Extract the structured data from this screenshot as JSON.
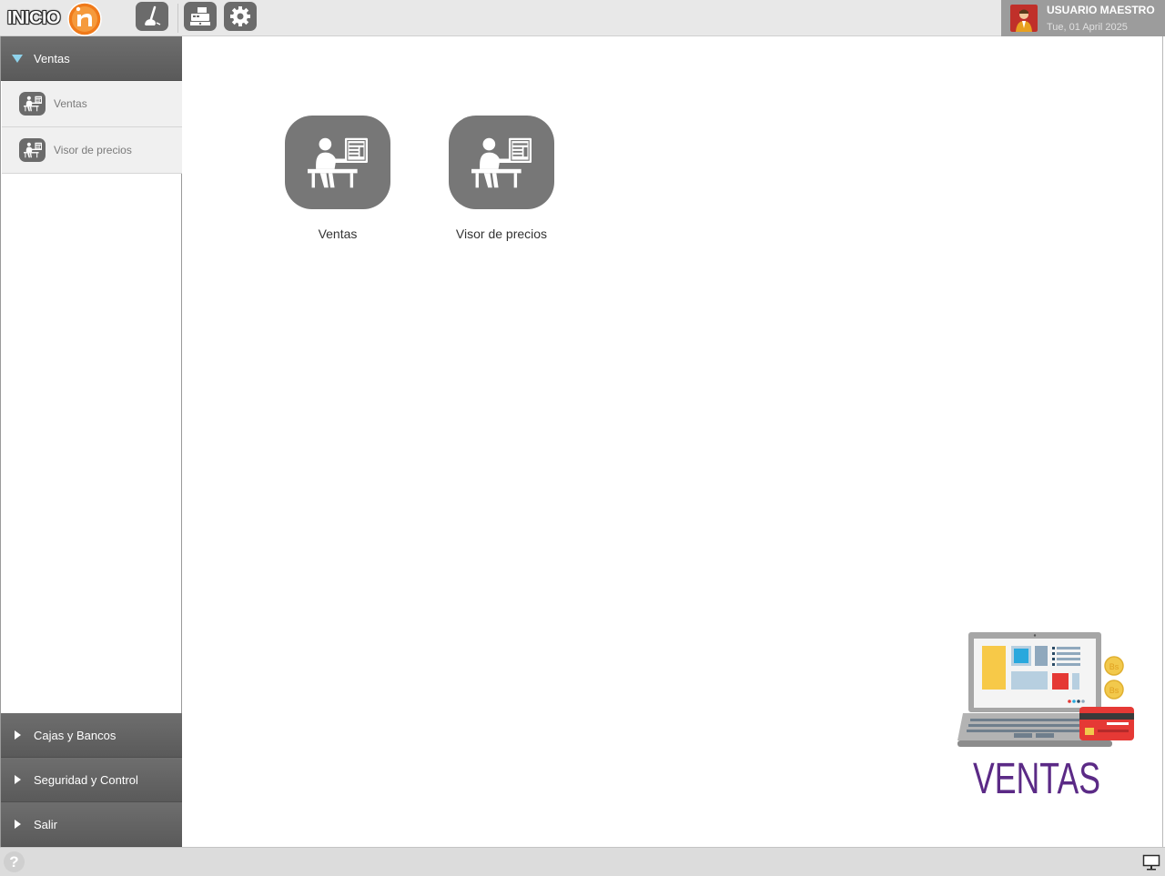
{
  "header": {
    "brand": "INICIO",
    "logo_letter": "n",
    "tools": [
      {
        "name": "broom-icon"
      },
      {
        "name": "cash-register-icon"
      },
      {
        "name": "gear-icon"
      }
    ],
    "user": {
      "name": "USUARIO MAESTRO",
      "date": "Tue, 01 April 2025"
    }
  },
  "sidebar": {
    "groups": [
      {
        "label": "Ventas",
        "expanded": true
      },
      {
        "label": "Cajas y Bancos",
        "expanded": false
      },
      {
        "label": "Seguridad y Control",
        "expanded": false
      },
      {
        "label": "Salir",
        "expanded": false
      }
    ],
    "items": [
      {
        "label": "Ventas",
        "icon": "cashier-desk-icon"
      },
      {
        "label": "Visor de precios",
        "icon": "cashier-desk-icon"
      }
    ]
  },
  "main": {
    "tiles": [
      {
        "label": "Ventas",
        "icon": "cashier-desk-icon"
      },
      {
        "label": "Visor de precios",
        "icon": "cashier-desk-icon"
      }
    ],
    "promo": {
      "title": "VENTAS",
      "coin_text": "Bs",
      "colors": {
        "title": "#5b2a86",
        "laptop": "#a8a8a8",
        "card": "#e23b3b",
        "coin": "#f2c94c"
      }
    }
  },
  "statusbar": {
    "help_symbol": "?"
  },
  "colors": {
    "accent_arrow": "#8fd3ec",
    "header_bg": "#e8e8e8",
    "sidebar_header": "#636363",
    "tile_bg": "#777777",
    "logo_orange": "#f07a1a"
  }
}
